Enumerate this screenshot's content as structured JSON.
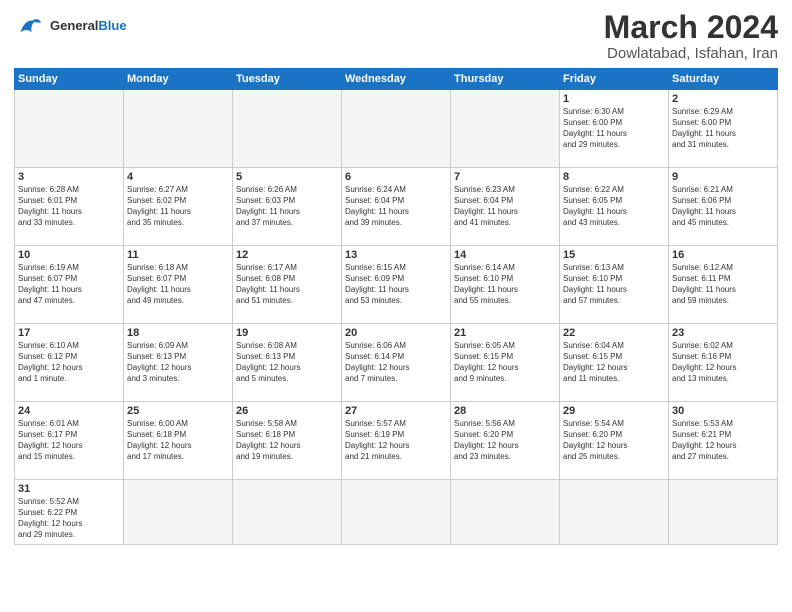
{
  "logo": {
    "line1": "General",
    "line2": "Blue"
  },
  "title": "March 2024",
  "subtitle": "Dowlatabad, Isfahan, Iran",
  "weekdays": [
    "Sunday",
    "Monday",
    "Tuesday",
    "Wednesday",
    "Thursday",
    "Friday",
    "Saturday"
  ],
  "weeks": [
    [
      {
        "day": "",
        "info": ""
      },
      {
        "day": "",
        "info": ""
      },
      {
        "day": "",
        "info": ""
      },
      {
        "day": "",
        "info": ""
      },
      {
        "day": "",
        "info": ""
      },
      {
        "day": "1",
        "info": "Sunrise: 6:30 AM\nSunset: 6:00 PM\nDaylight: 11 hours\nand 29 minutes."
      },
      {
        "day": "2",
        "info": "Sunrise: 6:29 AM\nSunset: 6:00 PM\nDaylight: 11 hours\nand 31 minutes."
      }
    ],
    [
      {
        "day": "3",
        "info": "Sunrise: 6:28 AM\nSunset: 6:01 PM\nDaylight: 11 hours\nand 33 minutes."
      },
      {
        "day": "4",
        "info": "Sunrise: 6:27 AM\nSunset: 6:02 PM\nDaylight: 11 hours\nand 35 minutes."
      },
      {
        "day": "5",
        "info": "Sunrise: 6:26 AM\nSunset: 6:03 PM\nDaylight: 11 hours\nand 37 minutes."
      },
      {
        "day": "6",
        "info": "Sunrise: 6:24 AM\nSunset: 6:04 PM\nDaylight: 11 hours\nand 39 minutes."
      },
      {
        "day": "7",
        "info": "Sunrise: 6:23 AM\nSunset: 6:04 PM\nDaylight: 11 hours\nand 41 minutes."
      },
      {
        "day": "8",
        "info": "Sunrise: 6:22 AM\nSunset: 6:05 PM\nDaylight: 11 hours\nand 43 minutes."
      },
      {
        "day": "9",
        "info": "Sunrise: 6:21 AM\nSunset: 6:06 PM\nDaylight: 11 hours\nand 45 minutes."
      }
    ],
    [
      {
        "day": "10",
        "info": "Sunrise: 6:19 AM\nSunset: 6:07 PM\nDaylight: 11 hours\nand 47 minutes."
      },
      {
        "day": "11",
        "info": "Sunrise: 6:18 AM\nSunset: 6:07 PM\nDaylight: 11 hours\nand 49 minutes."
      },
      {
        "day": "12",
        "info": "Sunrise: 6:17 AM\nSunset: 6:08 PM\nDaylight: 11 hours\nand 51 minutes."
      },
      {
        "day": "13",
        "info": "Sunrise: 6:15 AM\nSunset: 6:09 PM\nDaylight: 11 hours\nand 53 minutes."
      },
      {
        "day": "14",
        "info": "Sunrise: 6:14 AM\nSunset: 6:10 PM\nDaylight: 11 hours\nand 55 minutes."
      },
      {
        "day": "15",
        "info": "Sunrise: 6:13 AM\nSunset: 6:10 PM\nDaylight: 11 hours\nand 57 minutes."
      },
      {
        "day": "16",
        "info": "Sunrise: 6:12 AM\nSunset: 6:11 PM\nDaylight: 11 hours\nand 59 minutes."
      }
    ],
    [
      {
        "day": "17",
        "info": "Sunrise: 6:10 AM\nSunset: 6:12 PM\nDaylight: 12 hours\nand 1 minute."
      },
      {
        "day": "18",
        "info": "Sunrise: 6:09 AM\nSunset: 6:13 PM\nDaylight: 12 hours\nand 3 minutes."
      },
      {
        "day": "19",
        "info": "Sunrise: 6:08 AM\nSunset: 6:13 PM\nDaylight: 12 hours\nand 5 minutes."
      },
      {
        "day": "20",
        "info": "Sunrise: 6:06 AM\nSunset: 6:14 PM\nDaylight: 12 hours\nand 7 minutes."
      },
      {
        "day": "21",
        "info": "Sunrise: 6:05 AM\nSunset: 6:15 PM\nDaylight: 12 hours\nand 9 minutes."
      },
      {
        "day": "22",
        "info": "Sunrise: 6:04 AM\nSunset: 6:15 PM\nDaylight: 12 hours\nand 11 minutes."
      },
      {
        "day": "23",
        "info": "Sunrise: 6:02 AM\nSunset: 6:16 PM\nDaylight: 12 hours\nand 13 minutes."
      }
    ],
    [
      {
        "day": "24",
        "info": "Sunrise: 6:01 AM\nSunset: 6:17 PM\nDaylight: 12 hours\nand 15 minutes."
      },
      {
        "day": "25",
        "info": "Sunrise: 6:00 AM\nSunset: 6:18 PM\nDaylight: 12 hours\nand 17 minutes."
      },
      {
        "day": "26",
        "info": "Sunrise: 5:58 AM\nSunset: 6:18 PM\nDaylight: 12 hours\nand 19 minutes."
      },
      {
        "day": "27",
        "info": "Sunrise: 5:57 AM\nSunset: 6:19 PM\nDaylight: 12 hours\nand 21 minutes."
      },
      {
        "day": "28",
        "info": "Sunrise: 5:56 AM\nSunset: 6:20 PM\nDaylight: 12 hours\nand 23 minutes."
      },
      {
        "day": "29",
        "info": "Sunrise: 5:54 AM\nSunset: 6:20 PM\nDaylight: 12 hours\nand 25 minutes."
      },
      {
        "day": "30",
        "info": "Sunrise: 5:53 AM\nSunset: 6:21 PM\nDaylight: 12 hours\nand 27 minutes."
      }
    ],
    [
      {
        "day": "31",
        "info": "Sunrise: 5:52 AM\nSunset: 6:22 PM\nDaylight: 12 hours\nand 29 minutes."
      },
      {
        "day": "",
        "info": ""
      },
      {
        "day": "",
        "info": ""
      },
      {
        "day": "",
        "info": ""
      },
      {
        "day": "",
        "info": ""
      },
      {
        "day": "",
        "info": ""
      },
      {
        "day": "",
        "info": ""
      }
    ]
  ]
}
